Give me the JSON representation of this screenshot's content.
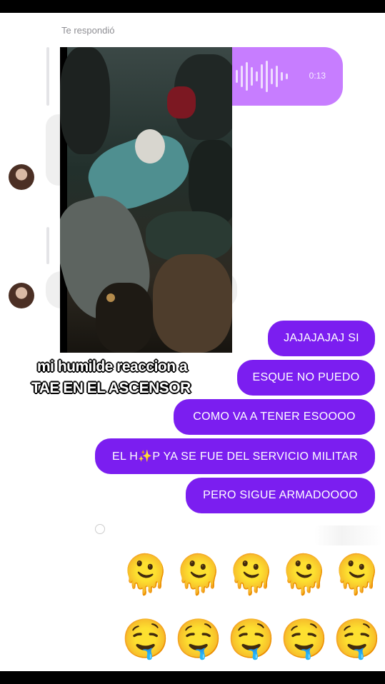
{
  "header": {
    "replied_label": "Te respondió"
  },
  "audio_message": {
    "duration": "0:13"
  },
  "video": {
    "caption_line1": "mi humilde reaccion a",
    "caption_line2": "TAE EN EL ASCENSOR"
  },
  "messages": [
    "JAJAJAJAJ SI",
    "ESQUE NO PUEDO",
    "COMO VA A TENER ESOOOO",
    "EL H✨P YA SE FUE DEL SERVICIO MILITAR",
    "PERO SIGUE ARMADOOOO"
  ],
  "reactions": {
    "row1": [
      "🫠",
      "🫠",
      "🫠",
      "🫠",
      "🫠"
    ],
    "row2": [
      "🤤",
      "🤤",
      "🤤",
      "🤤",
      "🤤"
    ]
  },
  "colors": {
    "sent_bubble": "#7b1ef0",
    "audio_bubble": "#c77dff",
    "received_bubble": "#efefef"
  }
}
